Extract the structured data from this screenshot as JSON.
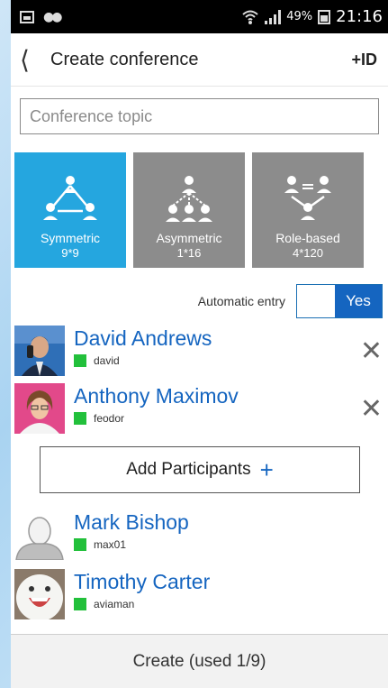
{
  "status_bar": {
    "battery": "49%",
    "time": "21:16"
  },
  "header": {
    "title": "Create conference",
    "id_label": "+ID"
  },
  "topic": {
    "placeholder": "Conference topic",
    "value": ""
  },
  "modes": [
    {
      "name": "Symmetric",
      "capacity": "9*9",
      "selected": true
    },
    {
      "name": "Asymmetric",
      "capacity": "1*16",
      "selected": false
    },
    {
      "name": "Role-based",
      "capacity": "4*120",
      "selected": false
    }
  ],
  "auto_entry": {
    "label": "Automatic entry",
    "state": "Yes"
  },
  "participants_added": [
    {
      "name": "David Andrews",
      "login": "david"
    },
    {
      "name": "Anthony Maximov",
      "login": "feodor"
    }
  ],
  "add_button": {
    "label": "Add Participants",
    "icon": "plus-icon"
  },
  "participants_suggested": [
    {
      "name": "Mark Bishop",
      "login": "max01"
    },
    {
      "name": "Timothy Carter",
      "login": "aviaman"
    }
  ],
  "create_button": {
    "label": "Create (used 1/9)"
  },
  "colors": {
    "accent": "#25a6df",
    "link": "#1565c0",
    "online": "#22c03b",
    "mode_inactive": "#8c8c8c"
  }
}
